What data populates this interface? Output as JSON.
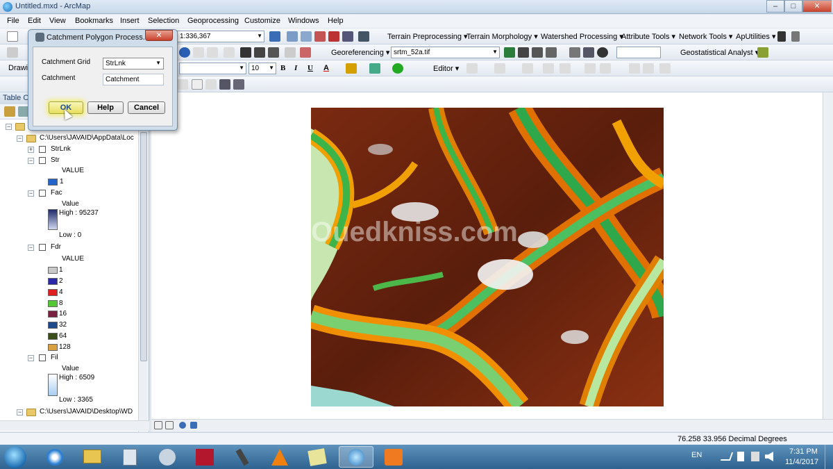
{
  "window": {
    "title": "Untitled.mxd - ArcMap",
    "minimize": "–",
    "maximize": "□",
    "close": "✕"
  },
  "menu": [
    "File",
    "Edit",
    "View",
    "Bookmarks",
    "Insert",
    "Selection",
    "Geoprocessing",
    "Customize",
    "Windows",
    "Help"
  ],
  "toolbar1": {
    "scale": "1:336,367",
    "menus": [
      "Terrain Preprocessing ▾",
      "Terrain Morphology ▾",
      "Watershed Processing ▾",
      "Attribute Tools ▾",
      "Network Tools ▾",
      "ApUtilities ▾"
    ]
  },
  "toolbar2": {
    "georeferencing": "Georeferencing ▾",
    "layer": "srtm_52a.tif",
    "geostat": "Geostatistical Analyst ▾"
  },
  "toolbar3": {
    "drawing": "Drawi",
    "font_size": "10",
    "bold": "B",
    "italic": "I",
    "underline": "U",
    "font_color": "A",
    "editor": "Editor ▾"
  },
  "toc": {
    "header": "Table O",
    "items": [
      {
        "label": "C:\\Users\\JAVAID\\AppData\\Loc"
      },
      {
        "label": "StrLnk"
      },
      {
        "label": "Str"
      },
      {
        "label": "VALUE"
      },
      {
        "label": "1"
      },
      {
        "label": "Fac"
      },
      {
        "label": "Value"
      },
      {
        "label": "High : 95237"
      },
      {
        "label": "Low : 0"
      },
      {
        "label": "Fdr"
      },
      {
        "label": "VALUE"
      },
      {
        "label": "Fil"
      },
      {
        "label": "Value"
      },
      {
        "label": "High : 6509"
      },
      {
        "label": "Low : 3365"
      },
      {
        "label": "C:\\Users\\JAVAID\\Desktop\\WD"
      }
    ],
    "fdr_classes": [
      {
        "label": "1",
        "color": "#c8c8c8"
      },
      {
        "label": "2",
        "color": "#2a2aa8"
      },
      {
        "label": "4",
        "color": "#e02020"
      },
      {
        "label": "8",
        "color": "#54c832"
      },
      {
        "label": "16",
        "color": "#7a2040"
      },
      {
        "label": "32",
        "color": "#1e4a8c"
      },
      {
        "label": "64",
        "color": "#3a4e1c"
      },
      {
        "label": "128",
        "color": "#d8a040"
      }
    ],
    "str_color": "#2266cc"
  },
  "dialog": {
    "title": "Catchment Polygon Process...",
    "grid_label": "Catchment Grid",
    "grid_value": "StrLnk",
    "catchment_label": "Catchment",
    "catchment_value": "Catchment",
    "ok": "OK",
    "help": "Help",
    "cancel": "Cancel"
  },
  "map": {
    "watermark": "Ouedkniss.com"
  },
  "status": {
    "coords": "76.258  33.956 Decimal Degrees"
  },
  "taskbar": {
    "lang": "EN",
    "time": "7:31 PM",
    "date": "11/4/2017"
  }
}
